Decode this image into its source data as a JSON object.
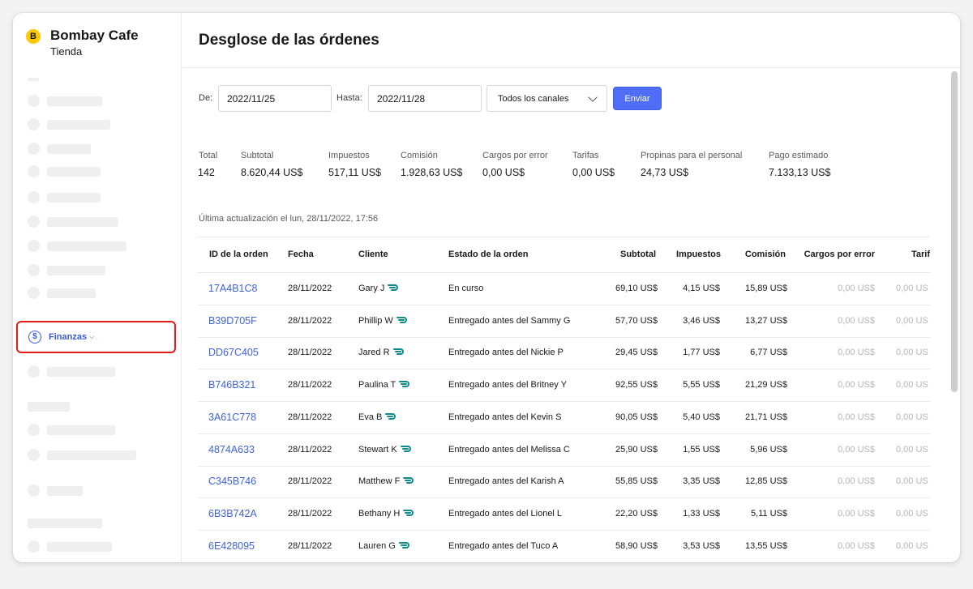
{
  "store": {
    "icon_letter": "B",
    "name": "Bombay Cafe",
    "subtitle": "Tienda"
  },
  "sidebar": {
    "active_item": {
      "label": "Finanzas",
      "icon": "dollar-circle-icon",
      "chevron": "chevron-down-icon"
    }
  },
  "page": {
    "title": "Desglose de las órdenes"
  },
  "filters": {
    "from_label": "De:",
    "from_value": "2022/11/25",
    "to_label": "Hasta:",
    "to_value": "2022/11/28",
    "channel_value": "Todos los canales",
    "submit_label": "Enviar"
  },
  "summary": [
    {
      "label": "Total",
      "value": "142"
    },
    {
      "label": "Subtotal",
      "value": "8.620,44 US$"
    },
    {
      "label": "Impuestos",
      "value": "517,11 US$"
    },
    {
      "label": "Comisión",
      "value": "1.928,63 US$"
    },
    {
      "label": "Cargos por error",
      "value": "0,00 US$"
    },
    {
      "label": "Tarifas",
      "value": "0,00 US$"
    },
    {
      "label": "Propinas para el personal",
      "value": "24,73 US$"
    },
    {
      "label": "Pago estimado",
      "value": "7.133,13 US$"
    }
  ],
  "updated_text": "Última actualización el lun, 28/11/2022, 17:56",
  "table": {
    "headers": [
      "ID de la orden",
      "Fecha",
      "Cliente",
      "Estado de la orden",
      "Subtotal",
      "Impuestos",
      "Comisión",
      "Cargos por error",
      "Tarif"
    ],
    "rows": [
      {
        "id": "17A4B1C8",
        "date": "28/11/2022",
        "customer": "Gary J",
        "status": "En curso",
        "subtotal": "69,10 US$",
        "tax": "4,15 US$",
        "commission": "15,89 US$",
        "error": "0,00 US$",
        "fees": "0,00 US"
      },
      {
        "id": "B39D705F",
        "date": "28/11/2022",
        "customer": "Phillip W",
        "status": "Entregado antes del Sammy G",
        "subtotal": "57,70 US$",
        "tax": "3,46 US$",
        "commission": "13,27 US$",
        "error": "0,00 US$",
        "fees": "0,00 US"
      },
      {
        "id": "DD67C405",
        "date": "28/11/2022",
        "customer": "Jared R",
        "status": "Entregado antes del Nickie P",
        "subtotal": "29,45 US$",
        "tax": "1,77 US$",
        "commission": "6,77 US$",
        "error": "0,00 US$",
        "fees": "0,00 US"
      },
      {
        "id": "B746B321",
        "date": "28/11/2022",
        "customer": "Paulina T",
        "status": "Entregado antes del Britney Y",
        "subtotal": "92,55 US$",
        "tax": "5,55 US$",
        "commission": "21,29 US$",
        "error": "0,00 US$",
        "fees": "0,00 US"
      },
      {
        "id": "3A61C778",
        "date": "28/11/2022",
        "customer": "Eva B",
        "status": "Entregado antes del Kevin S",
        "subtotal": "90,05 US$",
        "tax": "5,40 US$",
        "commission": "21,71 US$",
        "error": "0,00 US$",
        "fees": "0,00 US"
      },
      {
        "id": "4874A633",
        "date": "28/11/2022",
        "customer": "Stewart K",
        "status": "Entregado antes del Melissa C",
        "subtotal": "25,90 US$",
        "tax": "1,55 US$",
        "commission": "5,96 US$",
        "error": "0,00 US$",
        "fees": "0,00 US"
      },
      {
        "id": "C345B746",
        "date": "28/11/2022",
        "customer": "Matthew F",
        "status": "Entregado antes del Karish A",
        "subtotal": "55,85 US$",
        "tax": "3,35 US$",
        "commission": "12,85 US$",
        "error": "0,00 US$",
        "fees": "0,00 US"
      },
      {
        "id": "6B3B742A",
        "date": "28/11/2022",
        "customer": "Bethany H",
        "status": "Entregado antes del Lionel L",
        "subtotal": "22,20 US$",
        "tax": "1,33 US$",
        "commission": "5,11 US$",
        "error": "0,00 US$",
        "fees": "0,00 US"
      },
      {
        "id": "6E428095",
        "date": "28/11/2022",
        "customer": "Lauren G",
        "status": "Entregado antes del Tuco A",
        "subtotal": "58,90 US$",
        "tax": "3,53 US$",
        "commission": "13,55 US$",
        "error": "0,00 US$",
        "fees": "0,00 US"
      }
    ],
    "customer_icon": "dasher-icon"
  },
  "colors": {
    "accent": "#3f62d9",
    "button": "#4f6df5",
    "highlight": "#e31b1b",
    "brand": "#ffc907",
    "dasher": "#0f8a8a"
  }
}
